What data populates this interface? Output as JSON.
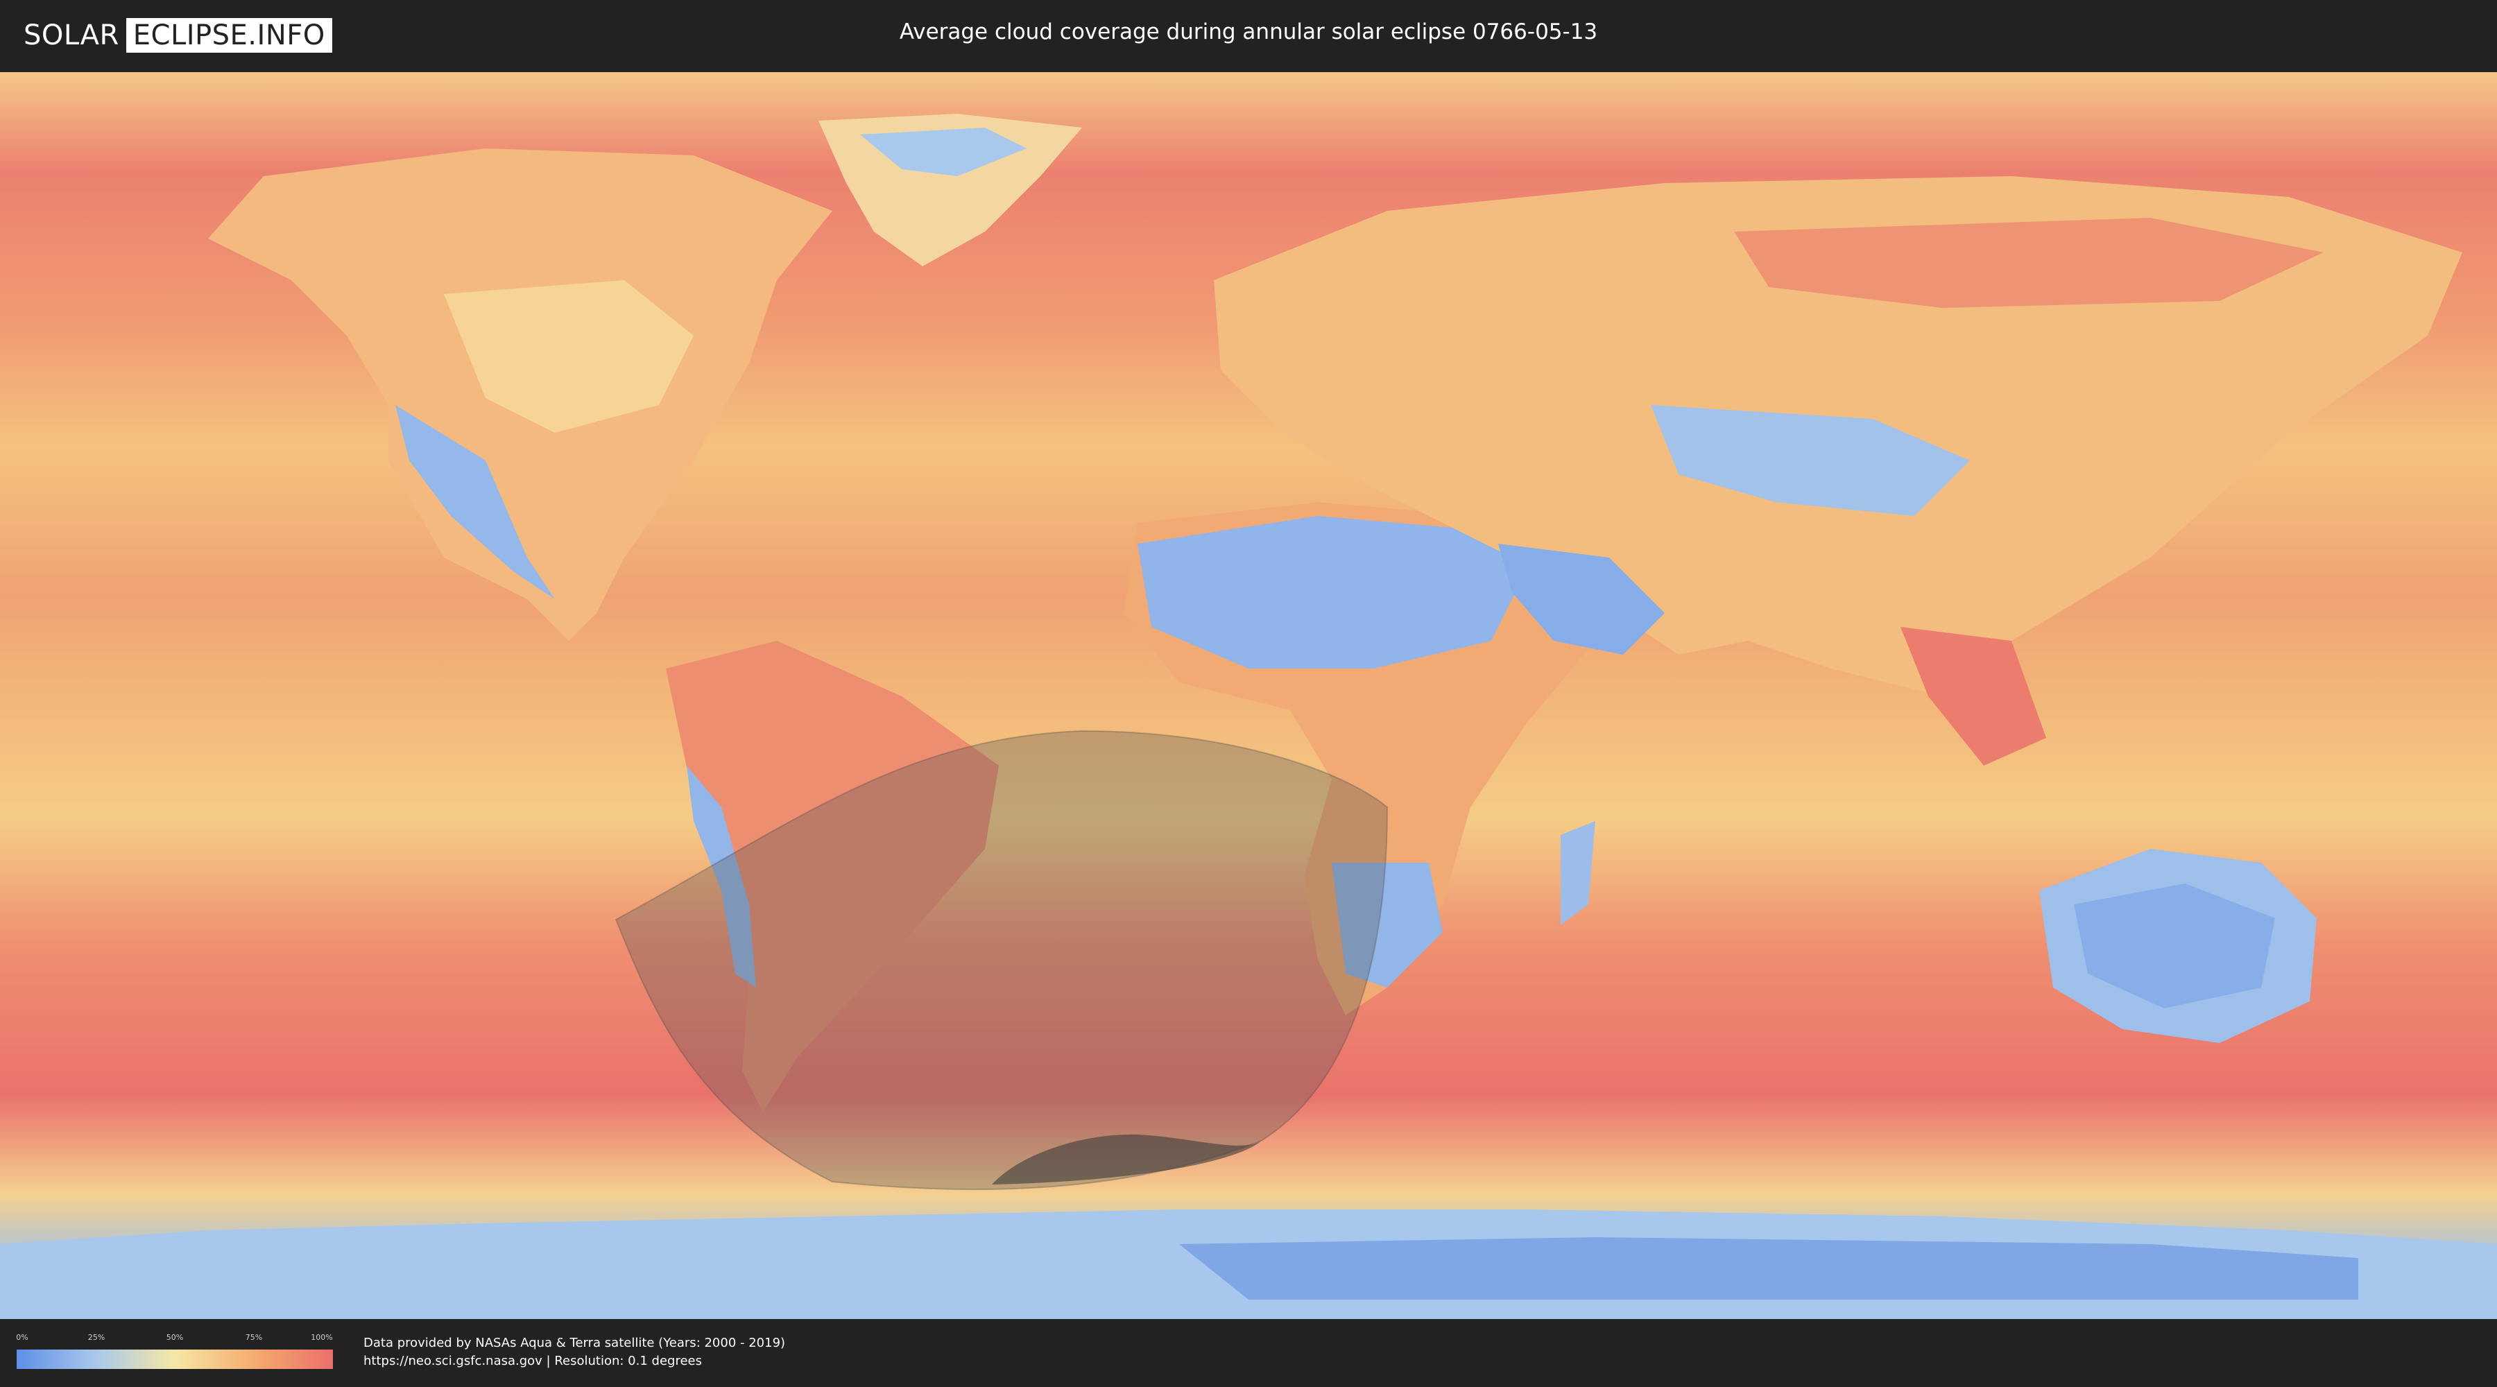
{
  "header": {
    "logo_part1": "SOLAR",
    "logo_part2": "ECLIPSE.INFO",
    "title": "Average cloud coverage during annular solar eclipse 0766-05-13"
  },
  "legend": {
    "ticks": [
      "0%",
      "25%",
      "50%",
      "75%",
      "100%"
    ],
    "colors": [
      "#5f8fe8",
      "#a9c8ec",
      "#f6e7a6",
      "#f5ac6f",
      "#ec6f6a"
    ]
  },
  "footer": {
    "credit_line1": "Data provided by NASAs Aqua & Terra satellite (Years: 2000 - 2019)",
    "credit_line2": "https://neo.sci.gsfc.nasa.gov | Resolution: 0.1 degrees"
  },
  "map": {
    "land_colors": {
      "ocean_cloudy": "#ec7a6e",
      "mid": "#f5b173",
      "light": "#f4d98f",
      "clear": "#8fb6ea",
      "very_clear": "#5d8de6"
    },
    "eclipse_shadow_color": "#555555"
  }
}
